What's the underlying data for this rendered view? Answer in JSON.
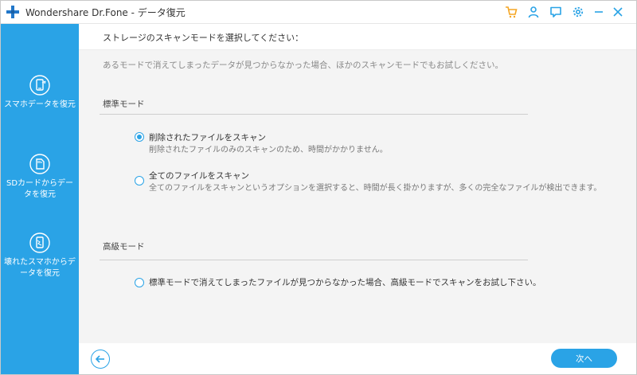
{
  "window": {
    "title": "Wondershare Dr.Fone - データ復元",
    "icons": [
      "plus-logo-icon",
      "cart-icon",
      "user-icon",
      "feedback-icon",
      "settings-icon",
      "minimize-icon",
      "close-icon"
    ],
    "accent_color": "#2aa3e6",
    "cart_color": "#f5a623"
  },
  "sidebar": {
    "items": [
      {
        "label": "スマホデータを復元",
        "icon": "phone-recover-icon"
      },
      {
        "label": "SDカードからデータを復元",
        "icon": "sd-card-icon"
      },
      {
        "label": "壊れたスマホからデータを復元",
        "icon": "broken-phone-icon"
      }
    ]
  },
  "main": {
    "header": "ストレージのスキャンモードを選択してください：",
    "hint": "あるモードで消えてしまったデータが見つからなかった場合、ほかのスキャンモードでもお試しください。",
    "standard": {
      "title": "標準モード",
      "options": [
        {
          "title": "削除されたファイルをスキャン",
          "desc": "削除されたファイルのみのスキャンのため、時間がかかりません。",
          "checked": true
        },
        {
          "title": "全てのファイルをスキャン",
          "desc": "全てのファイルをスキャンというオプションを選択すると、時間が長く掛かりますが、多くの完全なファイルが検出できます。",
          "checked": false
        }
      ]
    },
    "advanced": {
      "title": "高級モード",
      "options": [
        {
          "title": "標準モードで消えてしまったファイルが見つからなかった場合、高級モードでスキャンをお試し下さい。",
          "checked": false
        }
      ]
    }
  },
  "footer": {
    "back_icon": "back-arrow-icon",
    "next_label": "次へ"
  }
}
